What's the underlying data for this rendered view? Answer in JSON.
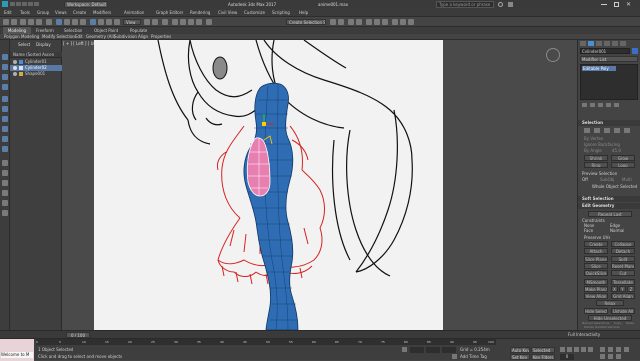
{
  "window": {
    "workspace_label": "Workspace: Default",
    "app_title": "Autodesk 3ds Max 2017",
    "file_name": "anime001.max",
    "search_placeholder": "Type a keyword or phrase"
  },
  "menu": [
    "Edit",
    "Tools",
    "Group",
    "Views",
    "Create",
    "Modifiers",
    "Animation",
    "Graph Editors",
    "Rendering",
    "Civil View",
    "Customize",
    "Scripting",
    "Help"
  ],
  "toolbar": {
    "view_dropdown": "View",
    "selection_set": "Create Selection Se"
  },
  "ribbon": {
    "tabs": [
      "Modeling",
      "Freeform",
      "Selection",
      "Object Paint",
      "Populate"
    ],
    "subtabs": [
      "Polygon Modeling",
      "Modify Selection",
      "Edit",
      "Geometry (All)",
      "Subdivision",
      "Align",
      "Properties"
    ]
  },
  "explorer": {
    "tabs": [
      "Select",
      "Display"
    ],
    "header": "Name (Sorted Ascen",
    "items": [
      "Cylinder01",
      "Cylinder02",
      "Shape001"
    ]
  },
  "viewport": {
    "label": "[ + ] [ Left ] [ User Defined ] [ Edged Faces ]"
  },
  "command_panel": {
    "object_name": "Cylinder001",
    "modifier_list_label": "Modifier List",
    "stack_item": "Editable Poly",
    "selection_title": "Selection",
    "selection_options": [
      "By Vertex",
      "Ignore Backfacing",
      "By Angle"
    ],
    "angle_value": "45.0",
    "selection_buttons": [
      "Shrink",
      "Grow",
      "Ring",
      "Loop"
    ],
    "preview_title": "Preview Selection",
    "preview_options": [
      "Off",
      "SubObj",
      "Multi"
    ],
    "whole_object_text": "Whole Object Selected",
    "soft_selection_title": "Soft Selection",
    "edit_geometry_title": "Edit Geometry",
    "repeat_last": "Repeat Last",
    "constraints_label": "Constraints",
    "constraint_options": [
      "None",
      "Edge",
      "Face",
      "Normal"
    ],
    "preserve_uvs": "Preserve UVs",
    "buttons": [
      "Create",
      "Collapse",
      "Attach",
      "Detach",
      "Slice Plane",
      "Split",
      "Slice",
      "Reset Plane",
      "QuickSlice",
      "Cut",
      "MSmooth",
      "Tessellate",
      "Make Planar",
      "X",
      "Y",
      "Z",
      "View Align",
      "Grid Align",
      "Relax",
      "Hide Selected",
      "Unhide All",
      "Hide Unselected"
    ],
    "named_selections_label": "Named Selections:",
    "copy_paste": [
      "Copy",
      "Paste"
    ],
    "delete_isolated": "Delete Isolated Vertices",
    "full_interactivity": "Full Interactivity"
  },
  "timeline": {
    "frame_counter": "0 / 100",
    "ticks": [
      "0",
      "5",
      "10",
      "15",
      "20",
      "25",
      "30",
      "35",
      "40",
      "45",
      "50",
      "55",
      "60",
      "65",
      "70",
      "75",
      "80",
      "85",
      "90",
      "95",
      "100"
    ]
  },
  "status": {
    "welcome": "Welcome to M",
    "objects_selected": "1 Object Selected",
    "prompt": "Click and drag to select and move objects",
    "grid": "Grid = 0.254m",
    "add_time_tag": "Add Time Tag",
    "auto_key": "Auto Key",
    "selected": "Selected",
    "set_key": "Set Key",
    "key_filters": "Key Filters...",
    "frame": "0"
  },
  "colors": {
    "mesh_blue": "#2e6db3",
    "selection_pink": "#e77fb0",
    "sketch_red": "#d62222",
    "accent_blue": "#4a8fd6"
  }
}
